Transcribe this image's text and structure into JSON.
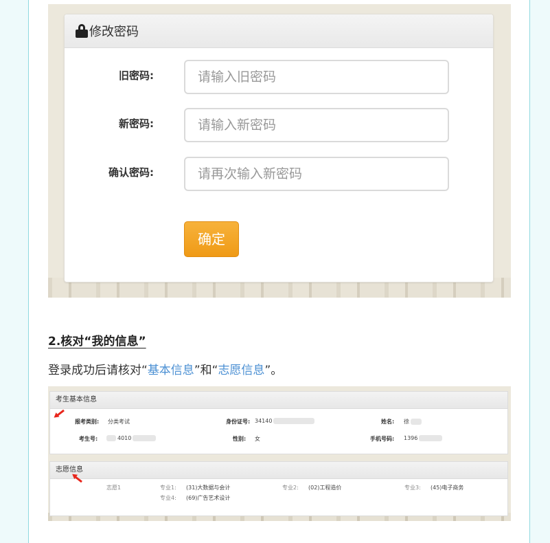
{
  "password_panel": {
    "title": "修改密码",
    "fields": [
      {
        "label": "旧密码:",
        "placeholder": "请输入旧密码"
      },
      {
        "label": "新密码:",
        "placeholder": "请输入新密码"
      },
      {
        "label": "确认密码:",
        "placeholder": "请再次输入新密码"
      }
    ],
    "submit_label": "确定"
  },
  "section": {
    "heading": "2.核对“我的信息”",
    "text_before": "登录成功后请核对“",
    "link1": "基本信息",
    "text_mid": "”和“",
    "link2": "志愿信息",
    "text_after": "”。"
  },
  "info_screenshot": {
    "basic_title": "考生基本信息",
    "basic": {
      "category_label": "报考类别:",
      "category_value": "分类考试",
      "id_label": "身份证号:",
      "id_value": "34140",
      "name_label": "姓名:",
      "name_value": "徐",
      "exam_no_label": "考生号:",
      "exam_no_value": "4010",
      "gender_label": "性别:",
      "gender_value": "女",
      "phone_label": "手机号码:",
      "phone_value": "1396"
    },
    "wish_title": "志愿信息",
    "wish": {
      "wish1_label": "志愿1",
      "major1_label": "专业1:",
      "major1_value": "(31)大数据与会计",
      "major2_label": "专业2:",
      "major2_value": "(02)工程造价",
      "major3_label": "专业3:",
      "major3_value": "(45)电子商务",
      "major4_label": "专业4:",
      "major4_value": "(69)广告艺术设计"
    }
  },
  "colors": {
    "accent_link": "#4a8fd3",
    "button_orange": "#ef9a16",
    "annotation_red": "#e8261c"
  }
}
